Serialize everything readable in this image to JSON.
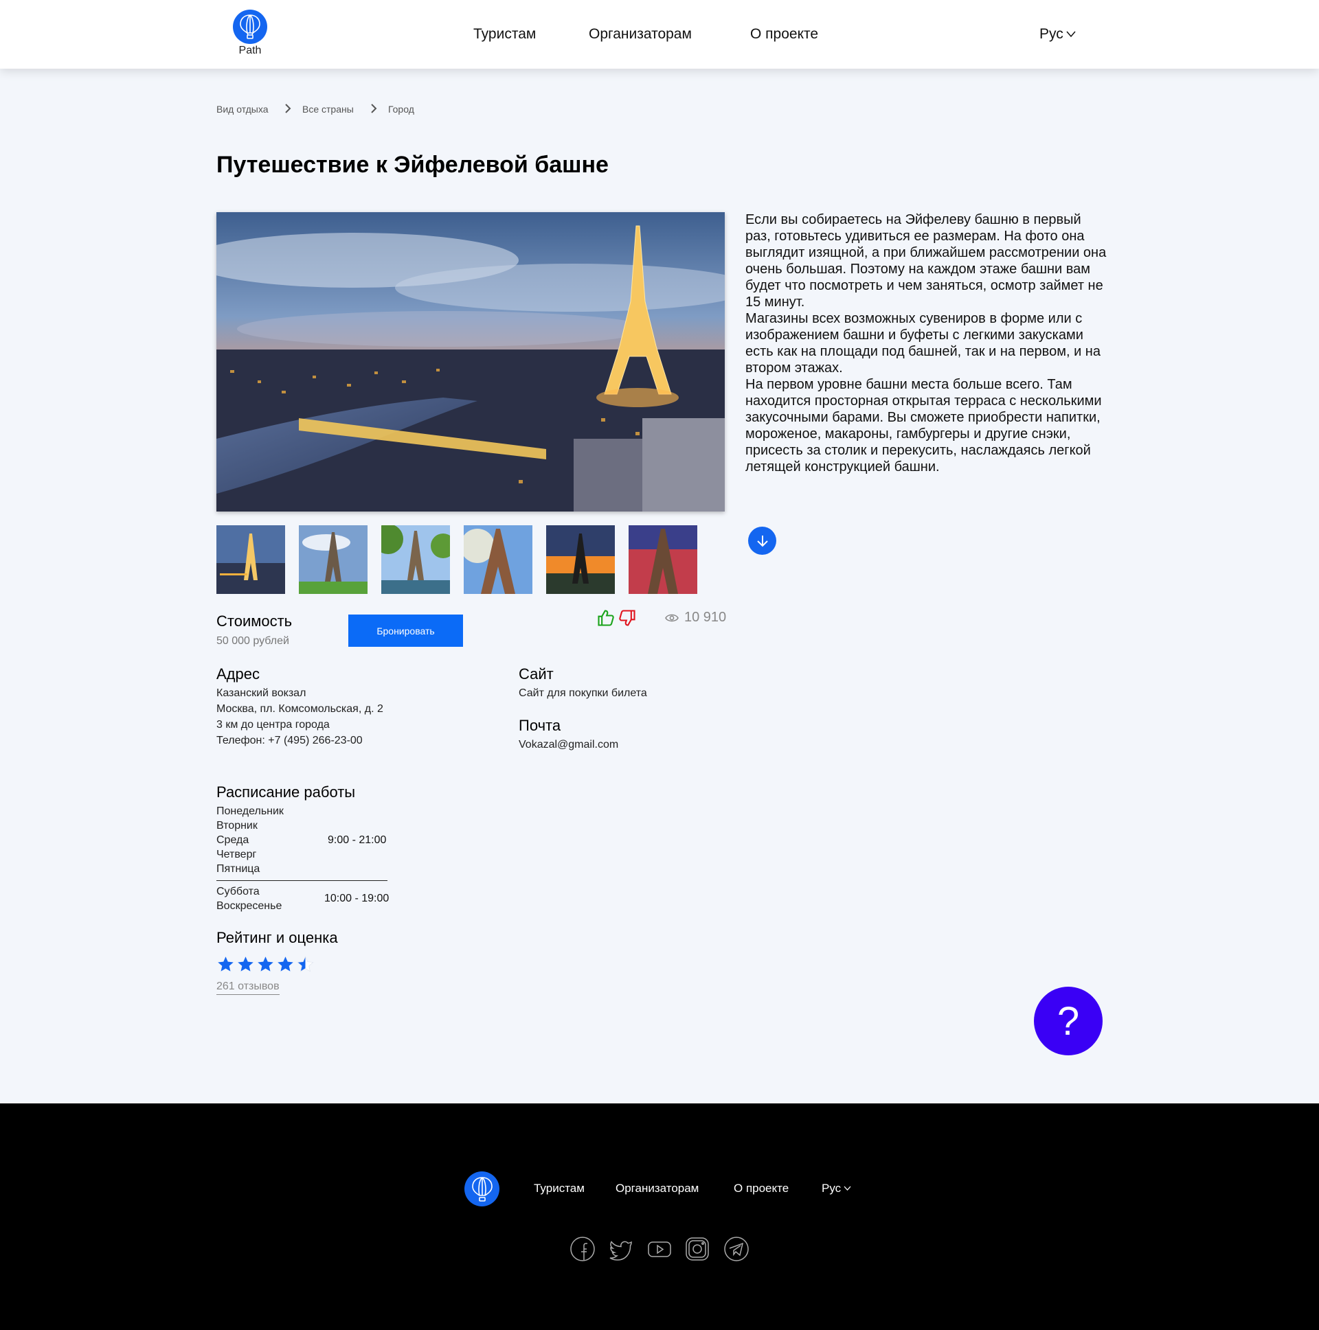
{
  "header": {
    "logo_text": "Path",
    "nav": [
      "Туристам",
      "Организаторам",
      "О проекте"
    ],
    "language": "Рус"
  },
  "breadcrumb": [
    "Вид отдыха",
    "Все страны",
    "Город"
  ],
  "title": "Путешествие к Эйфелевой башне",
  "description": "Если вы собираетесь на Эйфелеву башню в первый раз, готовьтесь удивиться ее размерам. На фото она выглядит изящной, а при ближайшем рассмотрении она очень большая. Поэтому на каждом этаже башни вам будет что посмотреть и чем заняться, осмотр займет не 15 минут.\nМагазины всех возможных сувениров в форме или с изображением башни и буфеты с легкими закусками есть как на площади под башней, так и на первом, и на втором этажах.\nНа первом уровне башни места больше всего. Там находится просторная открытая терраса с несколькими закусочными барами. Вы сможете приобрести напитки, мороженое, макароны, гамбургеры и другие снэки, присесть за столик и перекусить, наслаждаясь легкой летящей конструкцией башни.",
  "price": {
    "label": "Стоимость",
    "value": "50 000 рублей",
    "book_button": "Бронировать"
  },
  "views": "10 910",
  "address": {
    "label": "Адрес",
    "lines": [
      "Казанский вокзал",
      "Москва, пл. Комсомольская, д. 2",
      "3 км до центра города",
      "Телефон: +7 (495) 266-23-00"
    ]
  },
  "site": {
    "label": "Сайт",
    "value": "Сайт для покупки билета"
  },
  "mail": {
    "label": "Почта",
    "value": "Vokazal@gmail.com"
  },
  "schedule": {
    "label": "Расписание работы",
    "weekdays": [
      "Понедельник",
      "Вторник",
      "Среда",
      "Четверг",
      "Пятница"
    ],
    "weekday_hours": "9:00 - 21:00",
    "weekend": [
      "Суббота",
      "Воскресенье"
    ],
    "weekend_hours": "10:00 - 19:00"
  },
  "rating": {
    "label": "Рейтинг и оценка",
    "stars": 4.5,
    "reviews": "261 отзывов"
  },
  "help": "?",
  "footer": {
    "nav": [
      "Туристам",
      "Организаторам",
      "О проекте"
    ],
    "language": "Рус",
    "social": [
      "facebook-icon",
      "twitter-icon",
      "youtube-icon",
      "instagram-icon",
      "telegram-icon"
    ]
  },
  "colors": {
    "accent": "#1466f0",
    "button": "#0b6bf7",
    "help": "#3a00f5",
    "like": "#1aa31a",
    "dislike": "#e0141e",
    "star": "#1466f0"
  }
}
